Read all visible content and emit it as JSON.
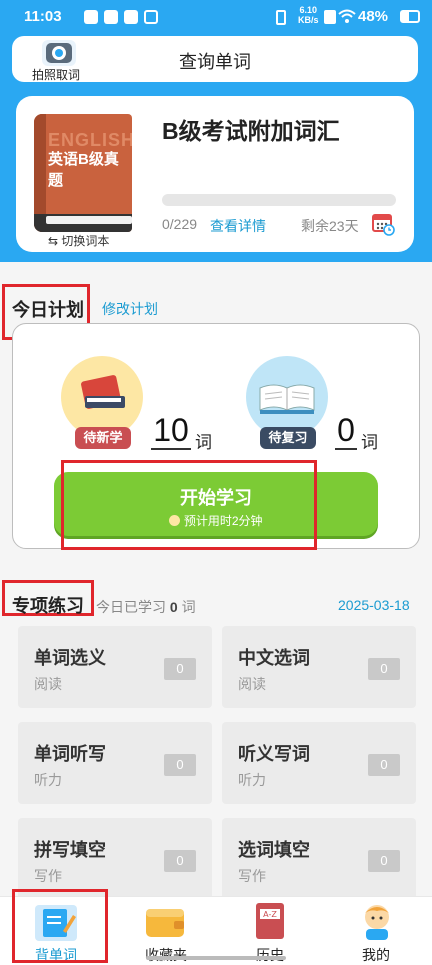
{
  "status": {
    "time": "11:03",
    "net_speed_top": "6.10",
    "net_speed_unit": "KB/s",
    "battery": "48%"
  },
  "search": {
    "camera_label": "拍照取词",
    "title": "查询单词"
  },
  "book": {
    "cover_en": "ENGLISH",
    "cover_cn": "英语B级真题",
    "switch_label": "切换词本",
    "title": "B级考试附加词汇",
    "progress_text": "0/229",
    "progress_fraction": 0,
    "details_link": "查看详情",
    "remaining": "剩余23天"
  },
  "plan": {
    "title": "今日计划",
    "edit_link": "修改计划",
    "new_tag": "待新学",
    "new_count": "10",
    "new_unit": "词",
    "review_tag": "待复习",
    "review_count": "0",
    "review_unit": "词",
    "start_label": "开始学习",
    "estimate": "预计用时2分钟"
  },
  "practice": {
    "title": "专项练习",
    "learned_prefix": "今日已学习",
    "learned_count": "0",
    "learned_suffix": "词",
    "date": "2025-03-18",
    "items": [
      {
        "name": "单词选义",
        "cat": "阅读",
        "count": "0"
      },
      {
        "name": "中文选词",
        "cat": "阅读",
        "count": "0"
      },
      {
        "name": "单词听写",
        "cat": "听力",
        "count": "0"
      },
      {
        "name": "听义写词",
        "cat": "听力",
        "count": "0"
      },
      {
        "name": "拼写填空",
        "cat": "写作",
        "count": "0"
      },
      {
        "name": "选词填空",
        "cat": "写作",
        "count": "0"
      }
    ]
  },
  "nav": {
    "items": [
      {
        "label": "背单词"
      },
      {
        "label": "收藏夹"
      },
      {
        "label": "历史"
      },
      {
        "label": "我的"
      }
    ]
  },
  "colors": {
    "blue": "#2aa8f2",
    "green": "#7ccb35",
    "red_box": "#e0262c",
    "link": "#1b9bd1"
  }
}
